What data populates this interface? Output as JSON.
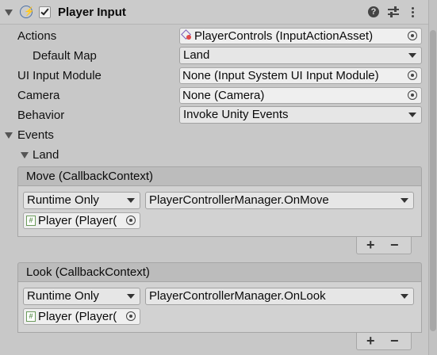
{
  "component": {
    "title": "Player Input",
    "enabled": true,
    "icons": [
      "lightning-icon",
      "help-icon",
      "preset-icon",
      "more-icon"
    ]
  },
  "properties": {
    "actions": {
      "label": "Actions",
      "value": "PlayerControls (InputActionAsset)",
      "icon": "input-asset-icon"
    },
    "default_map": {
      "label": "Default Map",
      "value": "Land"
    },
    "ui_input_module": {
      "label": "UI Input Module",
      "value": "None (Input System UI Input Module)"
    },
    "camera": {
      "label": "Camera",
      "value": "None (Camera)"
    },
    "behavior": {
      "label": "Behavior",
      "value": "Invoke Unity Events"
    }
  },
  "events": {
    "label": "Events",
    "map_label": "Land",
    "list": [
      {
        "header": "Move (CallbackContext)",
        "runtime": "Runtime Only",
        "function": "PlayerControllerManager.OnMove",
        "target": "Player (Player("
      },
      {
        "header": "Look (CallbackContext)",
        "runtime": "Runtime Only",
        "function": "PlayerControllerManager.OnLook",
        "target": "Player (Player("
      }
    ]
  },
  "buttons": {
    "plus": "+",
    "minus": "−"
  }
}
